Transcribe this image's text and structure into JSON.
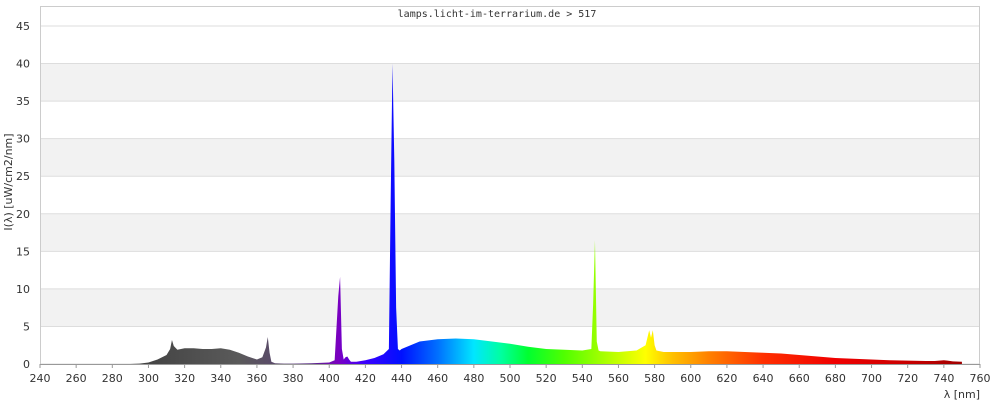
{
  "chart_data": {
    "type": "area",
    "title": "lamps.licht-im-terrarium.de > 517",
    "xlabel": "λ [nm]",
    "ylabel": "I(λ) [uW/cm2/nm]",
    "xlim": [
      240,
      760
    ],
    "ylim": [
      0,
      45
    ],
    "x_ticks": [
      240,
      260,
      280,
      300,
      320,
      340,
      360,
      380,
      400,
      420,
      440,
      460,
      480,
      500,
      520,
      540,
      560,
      580,
      600,
      620,
      640,
      660,
      680,
      700,
      720,
      740,
      760
    ],
    "y_ticks": [
      0,
      5,
      10,
      15,
      20,
      25,
      30,
      35,
      40,
      45
    ],
    "grid": true,
    "legend": "none",
    "series": [
      {
        "x": [
          240,
          290,
          295,
          300,
          305,
          310,
          312,
          313,
          314,
          316,
          318,
          320,
          325,
          330,
          335,
          340,
          345,
          350,
          355,
          360,
          363,
          365,
          366,
          367,
          368,
          370,
          375,
          380,
          390,
          400,
          403,
          405,
          406,
          407,
          408,
          409,
          410,
          411,
          412,
          415,
          420,
          425,
          430,
          433,
          434,
          435,
          436,
          437,
          438,
          439,
          440,
          445,
          450,
          460,
          470,
          480,
          490,
          500,
          510,
          520,
          530,
          540,
          545,
          546,
          547,
          548,
          549,
          550,
          560,
          570,
          575,
          577,
          578,
          579,
          580,
          581,
          585,
          590,
          600,
          610,
          620,
          630,
          640,
          650,
          660,
          670,
          680,
          690,
          700,
          710,
          720,
          730,
          735,
          740,
          742,
          745,
          750
        ],
        "y": [
          0,
          0,
          0.05,
          0.2,
          0.6,
          1.2,
          2.0,
          3.2,
          2.4,
          1.9,
          2.0,
          2.1,
          2.1,
          2.0,
          2.0,
          2.1,
          1.9,
          1.5,
          1.0,
          0.6,
          0.9,
          2.2,
          3.6,
          1.5,
          0.3,
          0.1,
          0.05,
          0.05,
          0.1,
          0.2,
          0.5,
          9.0,
          11.6,
          2.0,
          0.6,
          0.9,
          1.0,
          0.6,
          0.3,
          0.3,
          0.5,
          0.8,
          1.3,
          2.0,
          22.0,
          40.0,
          27.0,
          7.5,
          2.0,
          1.8,
          2.0,
          2.5,
          3.0,
          3.3,
          3.4,
          3.3,
          3.0,
          2.7,
          2.3,
          2.0,
          1.9,
          1.8,
          2.0,
          8.0,
          16.5,
          3.0,
          1.8,
          1.7,
          1.6,
          1.8,
          2.5,
          4.5,
          3.5,
          4.5,
          2.5,
          1.8,
          1.6,
          1.6,
          1.6,
          1.7,
          1.7,
          1.6,
          1.5,
          1.4,
          1.2,
          1.0,
          0.8,
          0.7,
          0.6,
          0.5,
          0.45,
          0.4,
          0.4,
          0.5,
          0.45,
          0.35,
          0.3
        ]
      }
    ],
    "colors": {
      "background": "#ffffff",
      "band_alt": "#f2f2f2",
      "gridline": "#dddddd",
      "frame": "#cccccc",
      "text": "#333333"
    }
  }
}
